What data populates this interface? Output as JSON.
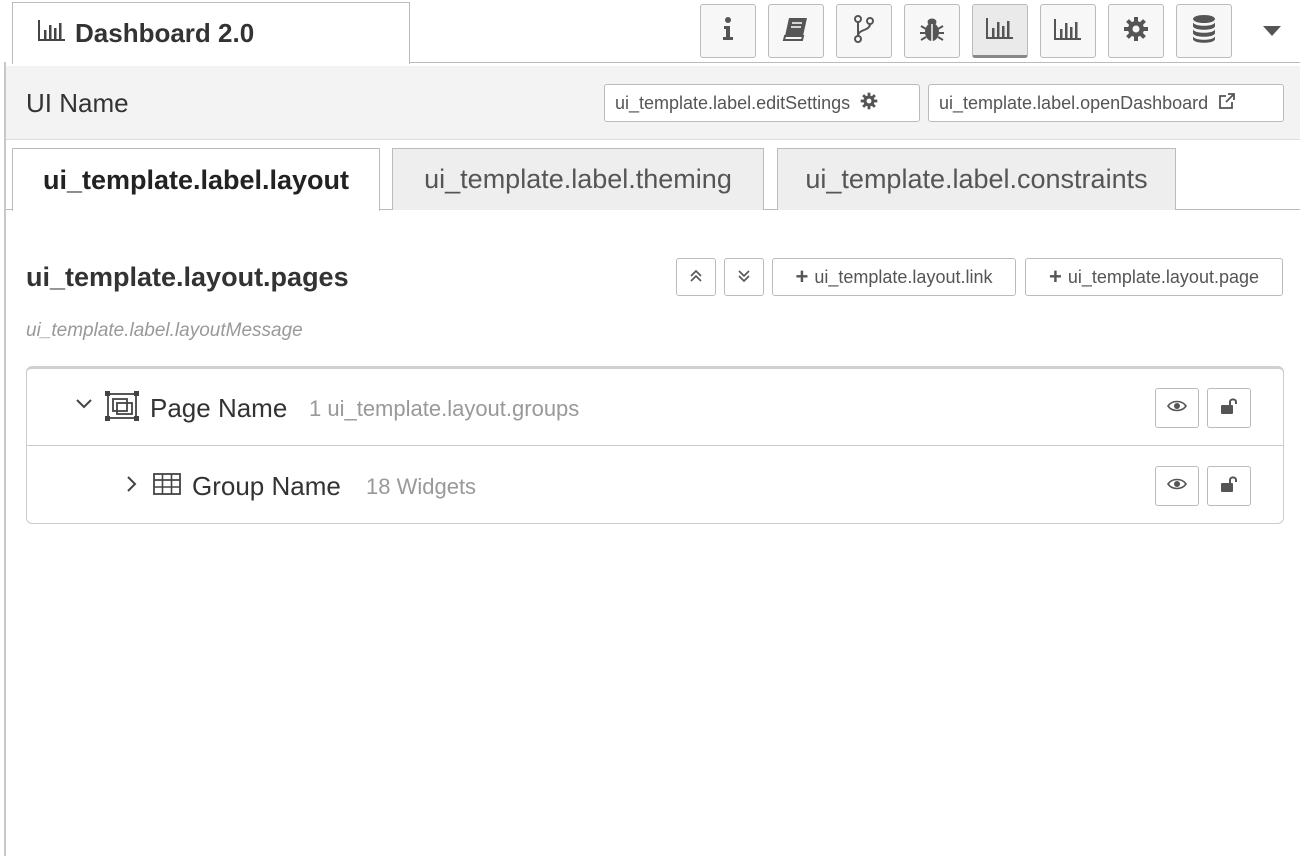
{
  "header": {
    "sidebar_tab_title": "Dashboard 2.0",
    "sidebar_tab_icon": "bar-chart-icon",
    "icon_buttons": [
      {
        "name": "info-icon",
        "active": false
      },
      {
        "name": "book-icon",
        "active": false
      },
      {
        "name": "git-branch-icon",
        "active": false
      },
      {
        "name": "bug-icon",
        "active": false
      },
      {
        "name": "bar-chart-icon",
        "active": true
      },
      {
        "name": "bar-chart-icon",
        "active": false
      },
      {
        "name": "gear-icon",
        "active": false
      },
      {
        "name": "database-icon",
        "active": false
      }
    ],
    "dropdown_icon": "caret-down-icon"
  },
  "subheader": {
    "ui_name": "UI Name",
    "edit_settings_label": "ui_template.label.editSettings",
    "open_dashboard_label": "ui_template.label.openDashboard"
  },
  "tabs": [
    {
      "label": "ui_template.label.layout",
      "active": true
    },
    {
      "label": "ui_template.label.theming",
      "active": false
    },
    {
      "label": "ui_template.label.constraints",
      "active": false
    }
  ],
  "layout": {
    "title": "ui_template.layout.pages",
    "message": "ui_template.label.layoutMessage",
    "link_button_label": "ui_template.layout.link",
    "page_button_label": "ui_template.layout.page"
  },
  "tree": {
    "page": {
      "name": "Page Name",
      "meta": "1 ui_template.layout.groups",
      "expanded": true
    },
    "group": {
      "name": "Group Name",
      "meta": "18 Widgets",
      "expanded": false
    }
  },
  "colors": {
    "border": "#bbbbbb",
    "subheader_bg": "#f3f3f3",
    "inactive_tab_bg": "#eeeeee",
    "muted_text": "#999999"
  }
}
